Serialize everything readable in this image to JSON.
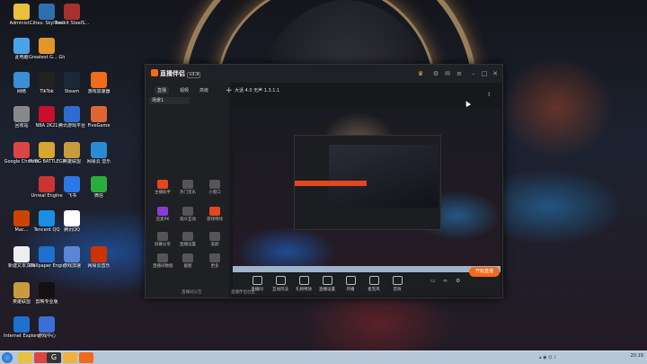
{
  "desktop_icons": [
    {
      "label": "Administ...",
      "color": "#e8c13c"
    },
    {
      "label": "Cities: Skylines",
      "color": "#2d6fb0"
    },
    {
      "label": "Toolkit SteelS...",
      "color": "#a8322b"
    },
    {
      "label": "此电脑",
      "color": "#4aa3e8"
    },
    {
      "label": "Greatest G... Global Off...",
      "color": "#e1952a"
    },
    {
      "label": "网络",
      "color": "#3b8fd6"
    },
    {
      "label": "TikTok",
      "color": "#222"
    },
    {
      "label": "Steam",
      "color": "#1b2838"
    },
    {
      "label": "游戏加速器",
      "color": "#f26a1b"
    },
    {
      "label": "回收站",
      "color": "#888"
    },
    {
      "label": "NBA 2K21",
      "color": "#c8102e"
    },
    {
      "label": "腾讯游戏平台",
      "color": "#2f6bd0"
    },
    {
      "label": "FiveGame",
      "color": "#d63"
    },
    {
      "label": "Google Chrome",
      "color": "#d44"
    },
    {
      "label": "PUBG BATTLEGR...",
      "color": "#d9a531"
    },
    {
      "label": "英雄联盟",
      "color": "#c89b3c"
    },
    {
      "label": "网易云 音乐",
      "color": "#2a8bd6"
    },
    {
      "label": "Unreal Engine",
      "color": "#c33"
    },
    {
      "label": "飞书",
      "color": "#2a78e4"
    },
    {
      "label": "微信",
      "color": "#2aae3a"
    },
    {
      "label": "Mac...",
      "color": "#c40"
    },
    {
      "label": "Tencent QQ",
      "color": "#1a8fe3"
    },
    {
      "label": "腾讯QQ",
      "color": "#fff"
    },
    {
      "label": "新建文本文档",
      "color": "#eee"
    },
    {
      "label": "Wallpaper Engine",
      "color": "#1e6fd0"
    },
    {
      "label": "游戏加速",
      "color": "#5a86d6"
    },
    {
      "label": "网易云音乐",
      "color": "#c30"
    },
    {
      "label": "英雄联盟",
      "color": "#c89b3c"
    },
    {
      "label": "剪映专业版",
      "color": "#111"
    },
    {
      "label": "Internet Explorer",
      "color": "#1d6fd0"
    },
    {
      "label": "游戏中心",
      "color": "#3a6fd6"
    }
  ],
  "app": {
    "brand": "直播伴侣",
    "version": "v3.8",
    "left_tabs": [
      "直播",
      "视频",
      "高级"
    ],
    "scene_label": "场景1",
    "tab_title": "大话 4.0 无声 1.3.1.1",
    "left_tiles": [
      "主播助手",
      "热门音乐",
      "小窗口",
      "连麦PK",
      "观众互动",
      "游戏特效",
      "屏幕分享",
      "直播设置",
      "美颜",
      "直播间数据",
      "截图",
      "更多"
    ],
    "bottom_tools": [
      "直播间",
      "互动玩法",
      "礼物特效",
      "直播设置",
      "开播",
      "麦克风",
      "音效"
    ],
    "start_button": "开始直播",
    "footer_links": [
      "直播间公告",
      "直播伴侣社区"
    ]
  },
  "taskbar": {
    "clock": "20:19"
  }
}
